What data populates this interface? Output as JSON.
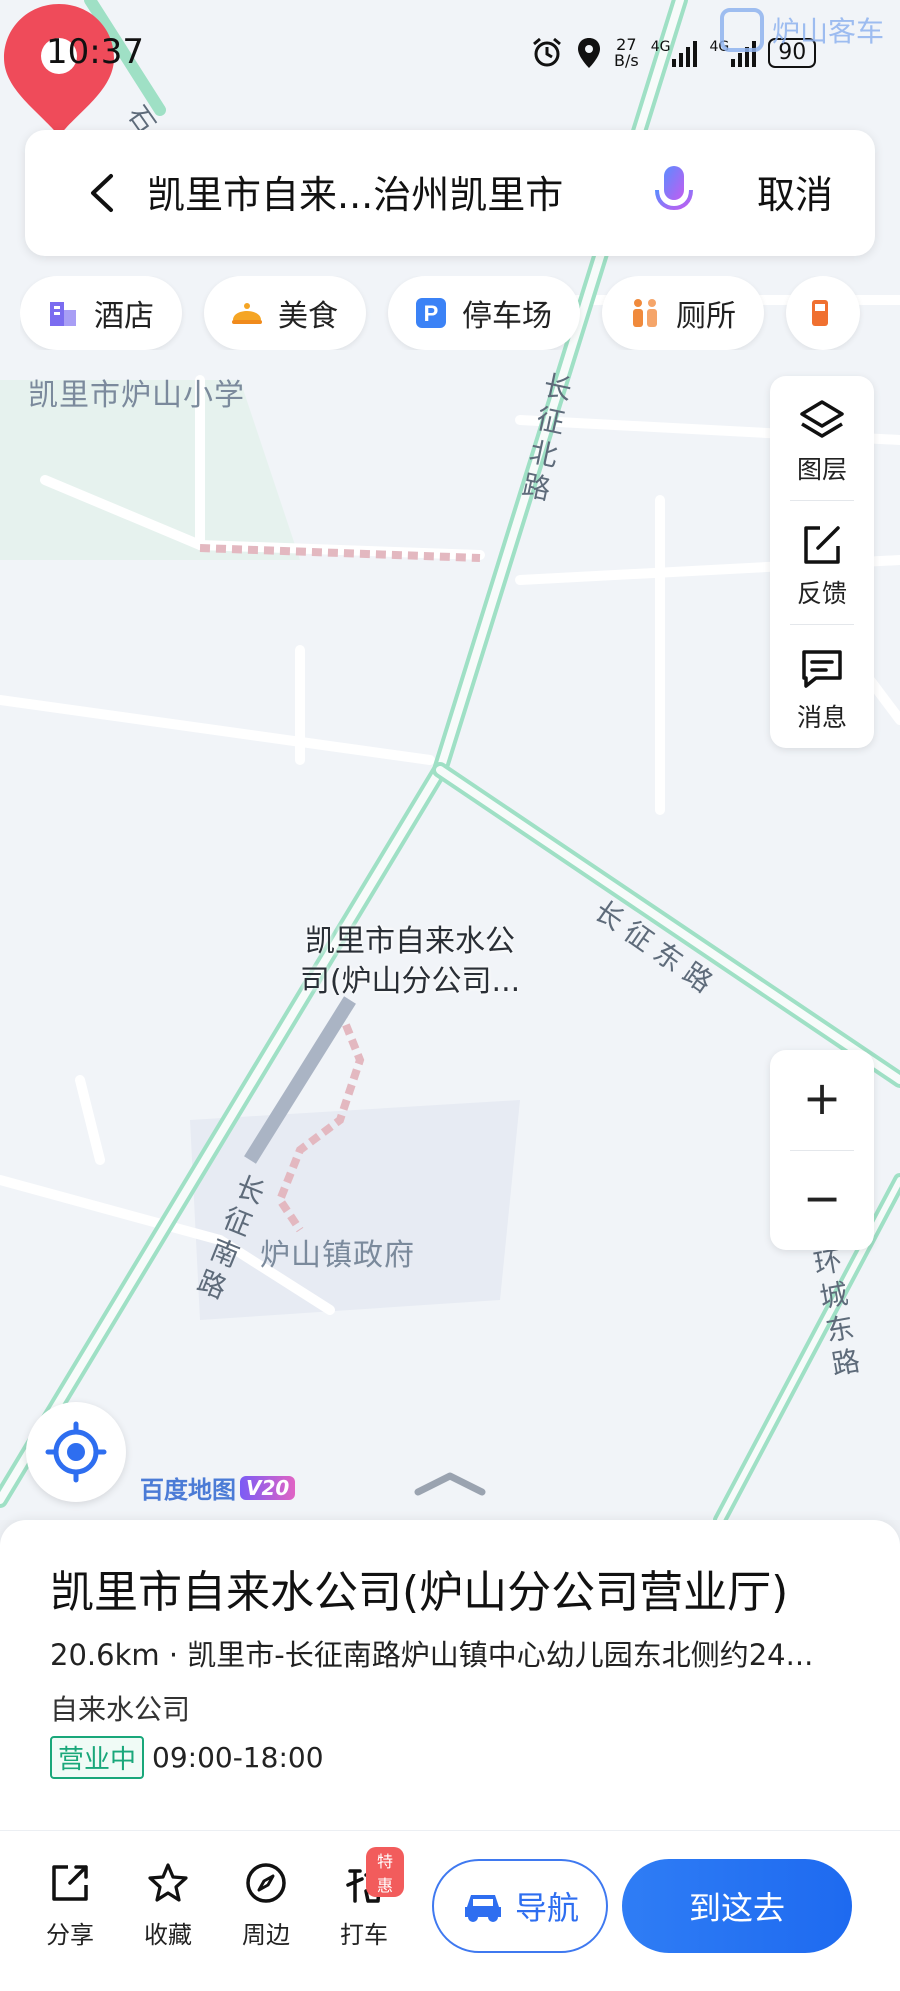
{
  "status_bar": {
    "time": "10:37",
    "net_speed_value": "27",
    "net_speed_unit": "B/s",
    "net1": "4G",
    "net2": "4G",
    "battery": "90"
  },
  "watermark": {
    "text": "炉山客车"
  },
  "search": {
    "query": "凯里市自来...治州凯里市",
    "cancel_label": "取消"
  },
  "categories": [
    {
      "label": "酒店",
      "icon": "hotel-icon",
      "color": "#7b6cf0"
    },
    {
      "label": "美食",
      "icon": "food-icon",
      "color": "#f5a524"
    },
    {
      "label": "停车场",
      "icon": "parking-icon",
      "color": "#3b82f6"
    },
    {
      "label": "厕所",
      "icon": "toilet-icon",
      "color": "#f08a3c"
    }
  ],
  "map": {
    "labels": {
      "school": "凯里市炉山小学",
      "govt": "炉山镇政府"
    },
    "roads": {
      "changzheng_north": "长征北路",
      "changzheng_east": "长征东路",
      "changzheng_south": "长征南路",
      "huancheng_east": "环城东路",
      "top_left_fragment": "石"
    },
    "poi_label_line1": "凯里市自来水公",
    "poi_label_line2": "司(炉山分公司...",
    "road_color": "#a8e6cf",
    "pin_color": "#ef4b5a"
  },
  "tools": {
    "layers_label": "图层",
    "feedback_label": "反馈",
    "messages_label": "消息"
  },
  "zoom": {
    "in": "+",
    "out": "−"
  },
  "logo": {
    "text": "百度地图",
    "version": "V20"
  },
  "place": {
    "title": "凯里市自来水公司(炉山分公司营业厅)",
    "address": "20.6km · 凯里市-长征南路炉山镇中心幼儿园东北侧约24...",
    "category": "自来水公司",
    "status_badge": "营业中",
    "hours": "09:00-18:00",
    "status_color": "#19a77a"
  },
  "actions": {
    "share": "分享",
    "favorite": "收藏",
    "nearby": "周边",
    "taxi": "打车",
    "taxi_promo": "特惠",
    "navigate": "导航",
    "go": "到这去",
    "accent": "#2f7df5"
  }
}
